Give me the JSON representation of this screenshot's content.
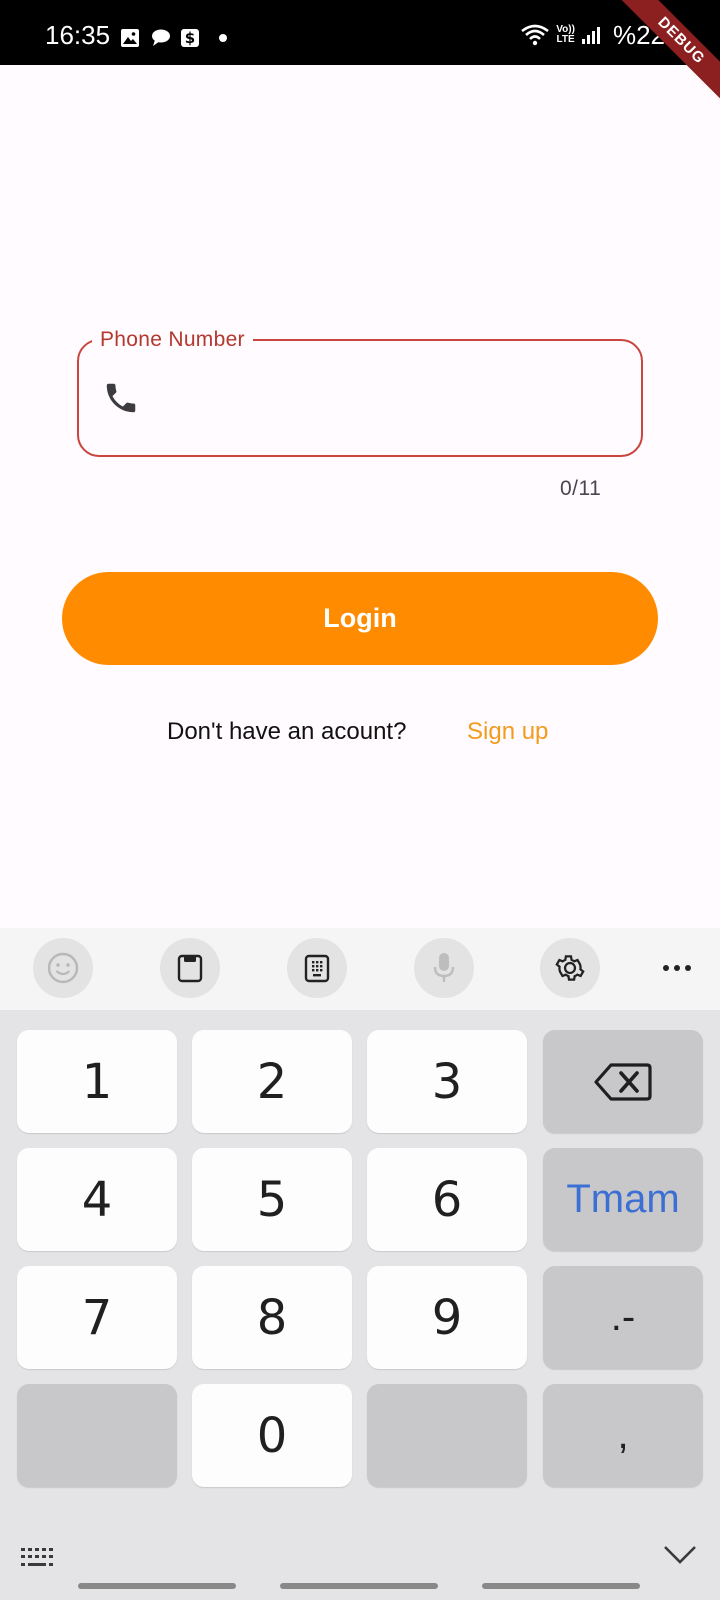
{
  "status_bar": {
    "time": "16:35",
    "left_icons": [
      "gallery-icon",
      "chat-icon",
      "dollar-icon",
      "dot-icon"
    ],
    "right_icons": [
      "wifi-icon",
      "volte-icon",
      "signal-icon"
    ],
    "volte_top": "Vo))",
    "volte_bottom": "LTE",
    "battery": "%22"
  },
  "debug_banner": "DEBUG",
  "phone_field": {
    "label": "Phone Number",
    "value": "",
    "counter": "0/11",
    "icon": "phone-icon",
    "border_color": "#c9453d"
  },
  "login_button": {
    "label": "Login",
    "color": "#ff8c00"
  },
  "signup": {
    "prompt": "Don't have an acount?",
    "link": "Sign up",
    "link_color": "#f29b1d"
  },
  "keyboard": {
    "toolbar": [
      "emoji-icon",
      "clipboard-icon",
      "keypad-icon",
      "microphone-icon",
      "settings-icon",
      "more-icon"
    ],
    "keys": {
      "k1": "1",
      "k2": "2",
      "k3": "3",
      "k4": "4",
      "k5": "5",
      "k6": "6",
      "k7": "7",
      "k8": "8",
      "k9": "9",
      "k0": "0",
      "done": "Tmam",
      "dot_dash": ".-",
      "comma": ","
    }
  }
}
